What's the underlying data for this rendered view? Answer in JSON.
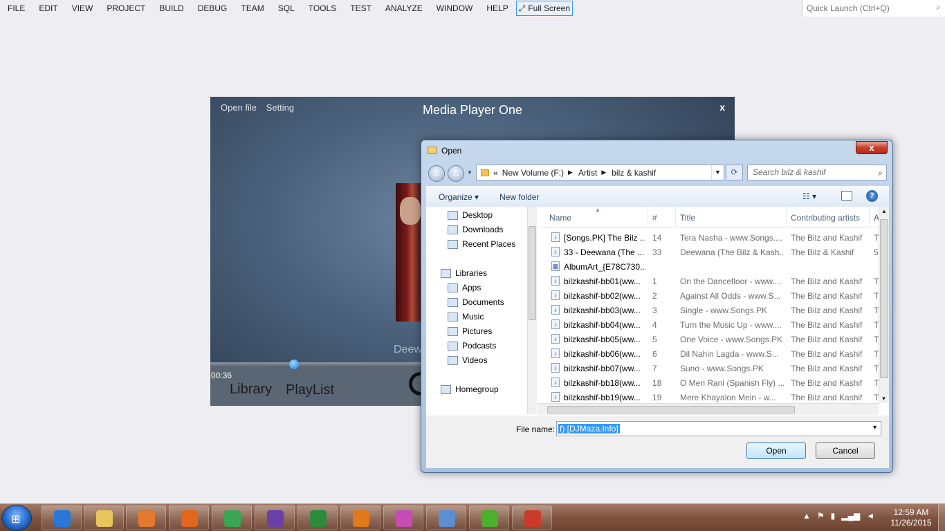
{
  "vs_menu": {
    "items": [
      "FILE",
      "EDIT",
      "VIEW",
      "PROJECT",
      "BUILD",
      "DEBUG",
      "TEAM",
      "SQL",
      "TOOLS",
      "TEST",
      "ANALYZE",
      "WINDOW",
      "HELP"
    ],
    "fullscreen_label": "Full Screen",
    "quick_launch_placeholder": "Quick Launch (Ctrl+Q)"
  },
  "media_player": {
    "menu_open_file": "Open file",
    "menu_setting": "Setting",
    "title": "Media Player One",
    "close_label": "x",
    "track_partial": "Deew",
    "time": "00:36",
    "progress_fraction": 0.36,
    "tab_library": "Library",
    "tab_playlist": "PlayList"
  },
  "dialog": {
    "title": "Open",
    "close_label": "x",
    "address": {
      "prefix": "«",
      "crumbs": [
        "New Volume (F:)",
        "Artist",
        "bilz & kashif"
      ]
    },
    "search_placeholder": "Search bilz & kashif",
    "toolbar": {
      "organize": "Organize ▾",
      "new_folder": "New folder",
      "help": "?"
    },
    "nav": [
      {
        "label": "Desktop",
        "icon": "desktop-icon",
        "indent": 1
      },
      {
        "label": "Downloads",
        "icon": "folder-icon",
        "indent": 1
      },
      {
        "label": "Recent Places",
        "icon": "recent-icon",
        "indent": 1
      },
      {
        "label": "Libraries",
        "icon": "libraries-icon",
        "indent": 0
      },
      {
        "label": "Apps",
        "icon": "apps-icon",
        "indent": 1
      },
      {
        "label": "Documents",
        "icon": "documents-icon",
        "indent": 1
      },
      {
        "label": "Music",
        "icon": "music-icon",
        "indent": 1
      },
      {
        "label": "Pictures",
        "icon": "pictures-icon",
        "indent": 1
      },
      {
        "label": "Podcasts",
        "icon": "folder-icon",
        "indent": 1
      },
      {
        "label": "Videos",
        "icon": "videos-icon",
        "indent": 1
      },
      {
        "label": "Homegroup",
        "icon": "homegroup-icon",
        "indent": 0
      }
    ],
    "columns": [
      "Name",
      "#",
      "Title",
      "Contributing artists",
      "A"
    ],
    "files": [
      {
        "name": "[Songs.PK] The Bilz ...",
        "num": "14",
        "title": "Tera Nasha - www.Songs....",
        "artist": "The Bilz and Kashif",
        "extra": "T",
        "type": "audio"
      },
      {
        "name": "33 - Deewana (The ...",
        "num": "33",
        "title": "Deewana (The Bilz & Kash...",
        "artist": "The Bilz & Kashif",
        "extra": "5",
        "type": "audio"
      },
      {
        "name": "AlbumArt_{E78C730...",
        "num": "",
        "title": "",
        "artist": "",
        "extra": "",
        "type": "image"
      },
      {
        "name": "bilzkashif-bb01(ww...",
        "num": "1",
        "title": "On the Dancefloor - www....",
        "artist": "The Bilz and Kashif",
        "extra": "T",
        "type": "audio"
      },
      {
        "name": "bilzkashif-bb02(ww...",
        "num": "2",
        "title": "Against All Odds - www.S...",
        "artist": "The Bilz and Kashif",
        "extra": "T",
        "type": "audio"
      },
      {
        "name": "bilzkashif-bb03(ww...",
        "num": "3",
        "title": "Single - www.Songs.PK",
        "artist": "The Bilz and Kashif",
        "extra": "T",
        "type": "audio"
      },
      {
        "name": "bilzkashif-bb04(ww...",
        "num": "4",
        "title": "Turn the Music Up - www....",
        "artist": "The Bilz and Kashif",
        "extra": "T",
        "type": "audio"
      },
      {
        "name": "bilzkashif-bb05(ww...",
        "num": "5",
        "title": "One Voice - www.Songs.PK",
        "artist": "The Bilz and Kashif",
        "extra": "T",
        "type": "audio"
      },
      {
        "name": "bilzkashif-bb06(ww...",
        "num": "6",
        "title": "Dil Nahin Lagda - www.S...",
        "artist": "The Bilz and Kashif",
        "extra": "T",
        "type": "audio"
      },
      {
        "name": "bilzkashif-bb07(ww...",
        "num": "7",
        "title": "Suno - www.Songs.PK",
        "artist": "The Bilz and Kashif",
        "extra": "T",
        "type": "audio"
      },
      {
        "name": "bilzkashif-bb18(ww...",
        "num": "18",
        "title": "O Meri Rani (Spanish Fly) ...",
        "artist": "The Bilz and Kashif",
        "extra": "T",
        "type": "audio"
      },
      {
        "name": "bilzkashif-bb19(ww...",
        "num": "19",
        "title": "Mere Khayalon Mein - w...",
        "artist": "The Bilz and Kashif",
        "extra": "T",
        "type": "audio"
      }
    ],
    "file_name_label": "File name:",
    "file_name_value": "f) [DJMaza.Info]",
    "open_button": "Open",
    "cancel_button": "Cancel"
  },
  "taskbar": {
    "apps": [
      "internet-explorer-icon",
      "file-explorer-icon",
      "media-player-icon",
      "firefox-icon",
      "chrome-icon",
      "visual-studio-icon",
      "download-manager-icon",
      "pdf-icon",
      "picasa-icon",
      "notepad-icon",
      "utorrent-icon",
      "app-window-icon"
    ],
    "time": "12:59 AM",
    "date": "11/26/2015"
  },
  "colors": {
    "accent": "#3399ff",
    "taskbar": "#7f533f",
    "close_red": "#c7402b"
  }
}
